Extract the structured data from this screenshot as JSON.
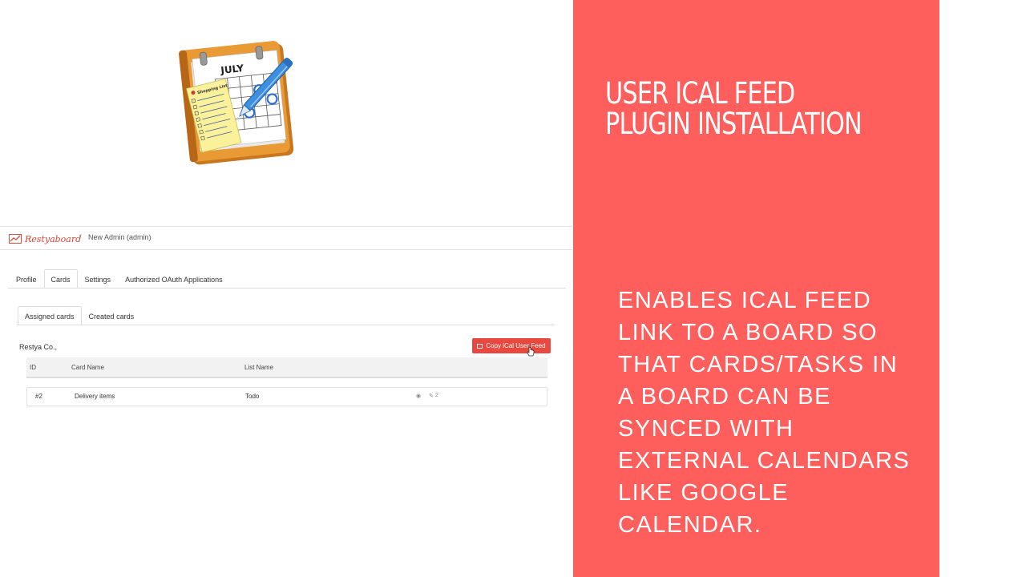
{
  "app": {
    "brand": "Restyaboard",
    "breadcrumb_separator": "/",
    "breadcrumb_current": "New Admin (admin)",
    "main_tabs": [
      {
        "label": "Profile",
        "active": false
      },
      {
        "label": "Cards",
        "active": true
      },
      {
        "label": "Settings",
        "active": false
      },
      {
        "label": "Authorized OAuth Applications",
        "active": false
      }
    ],
    "sub_tabs": [
      {
        "label": "Assigned cards",
        "active": true
      },
      {
        "label": "Created cards",
        "active": false
      }
    ],
    "organization": "Restya Co.,",
    "copy_button_label": "Copy iCal User Feed",
    "table": {
      "headers": [
        "ID",
        "Card Name",
        "List Name"
      ],
      "rows": [
        {
          "id": "#2",
          "card_name": "Delivery items",
          "list_name": "Todo",
          "comments": "2"
        }
      ]
    }
  },
  "icon": {
    "name": "calendar-notebook-icon",
    "month_label": "JULY",
    "list_label": "Shopping List"
  },
  "panel": {
    "title": "USER ICAL FEED PLUGIN INSTALLATION",
    "body": "ENABLES ICAL FEED LINK TO A BOARD SO THAT CARDS/TASKS IN A BOARD CAN BE SYNCED WITH EXTERNAL CALENDARS LIKE GOOGLE CALENDAR.",
    "background": "#fe5e5c",
    "text_color": "#ffffff"
  },
  "colors": {
    "accent_red": "#e8483e",
    "brand_red": "#d9453b"
  }
}
